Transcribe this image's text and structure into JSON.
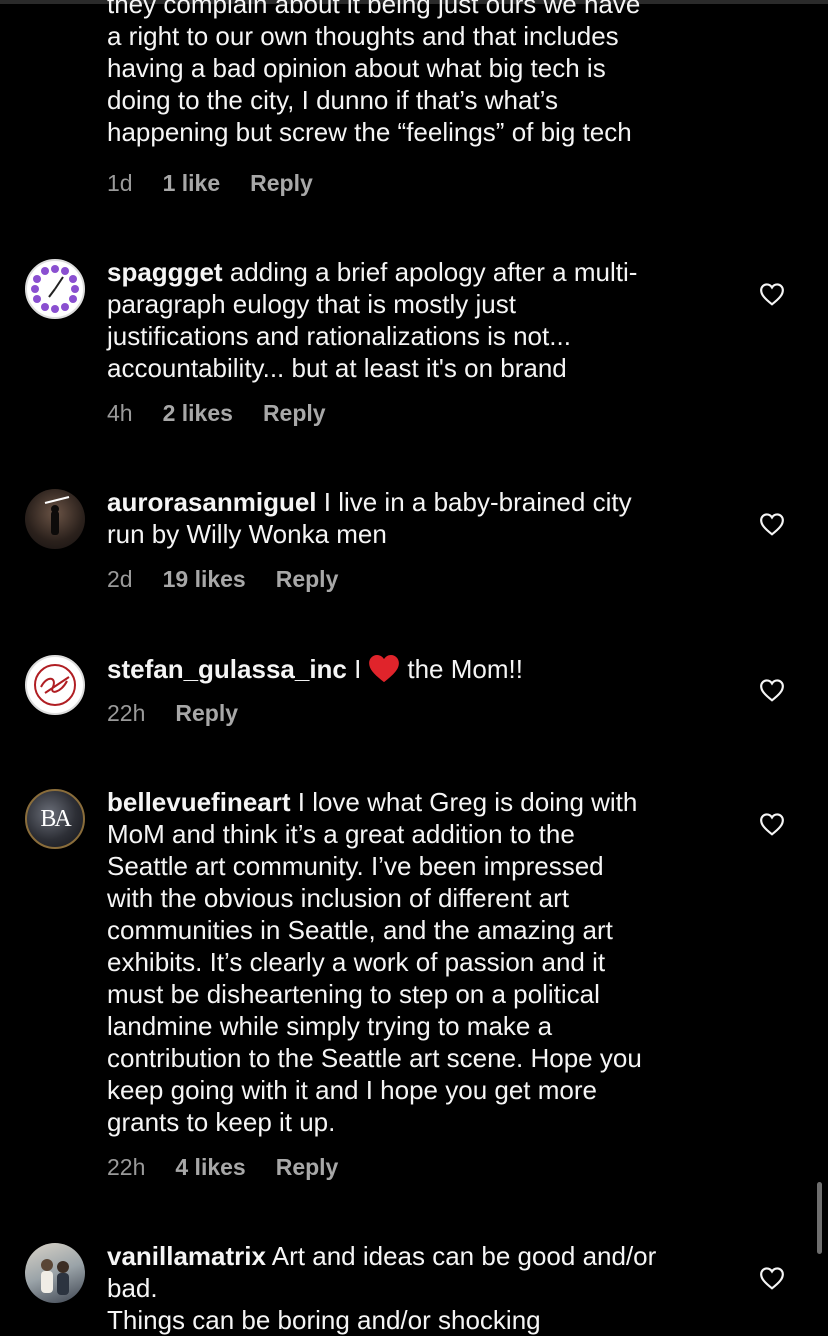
{
  "comments": [
    {
      "username": "",
      "text": "they complain about it being just ours we have\na right to our own thoughts and that includes\nhaving a bad opinion about what big tech is\ndoing to the city, I dunno if that’s what’s\nhappening but screw the “feelings” of big tech",
      "time": "1d",
      "likes": "1 like",
      "reply": "Reply"
    },
    {
      "username": "spaggget",
      "text": "adding a brief apology after a multi-\nparagraph eulogy that is mostly just\njustifications and rationalizations is not...\naccountability... but at least it's on brand",
      "time": "4h",
      "likes": "2 likes",
      "reply": "Reply"
    },
    {
      "username": "aurorasanmiguel",
      "text": "I live in a baby-brained city\nrun by Willy Wonka men",
      "time": "2d",
      "likes": "19 likes",
      "reply": "Reply"
    },
    {
      "username": "stefan_gulassa_inc",
      "text_before": "I",
      "text_after": "the Mom!!",
      "time": "22h",
      "reply": "Reply"
    },
    {
      "username": "bellevuefineart",
      "avatar_text": "BA",
      "text": "I love what Greg is doing with\nMoM and think it’s a great addition to the\nSeattle art community. I’ve been impressed\nwith the obvious inclusion of different art\ncommunities in Seattle, and the amazing art\nexhibits. It’s clearly a work of passion and it\nmust be disheartening to step on a political\nlandmine while simply trying to make a\ncontribution to the Seattle art scene. Hope you\nkeep going with it and I hope you get more\ngrants to keep it up.",
      "time": "22h",
      "likes": "4 likes",
      "reply": "Reply"
    },
    {
      "username": "vanillamatrix",
      "text": "Art and ideas can be good and/or\nbad.\nThings can be boring and/or shocking"
    }
  ],
  "icons": {
    "like": "heart-outline-icon",
    "emoji": "red-heart-emoji"
  },
  "colors": {
    "background": "#000000",
    "text": "#f5f5f5",
    "secondary": "#9a9a9a",
    "emoji_red": "#e0242b"
  }
}
